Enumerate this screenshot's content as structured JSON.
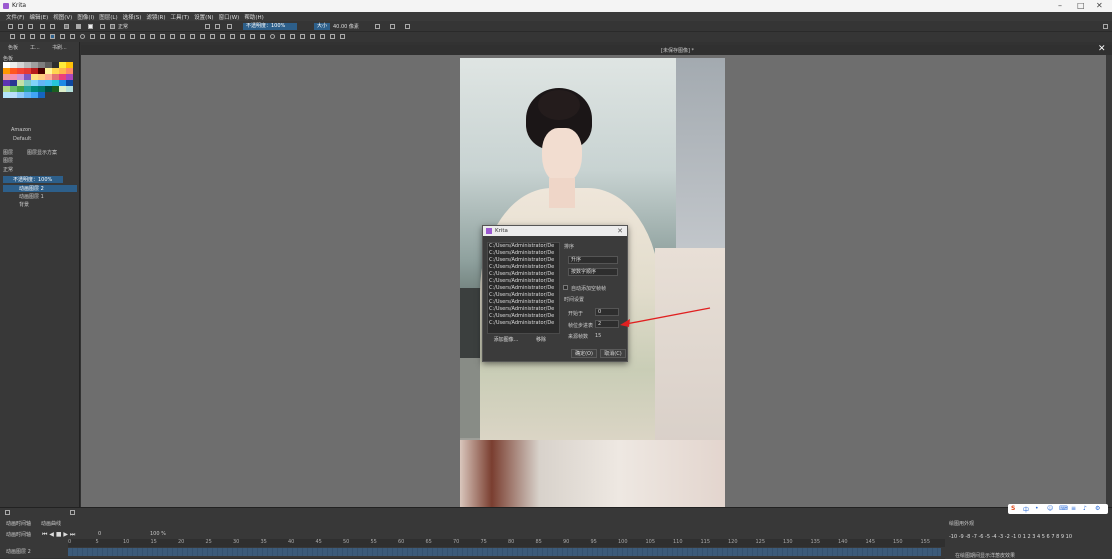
{
  "window": {
    "title": "Krita",
    "min": "–",
    "max": "□",
    "close": "✕"
  },
  "menu": [
    "文件(F)",
    "编辑(E)",
    "视图(V)",
    "图像(I)",
    "图层(L)",
    "选择(S)",
    "滤镜(R)",
    "工具(T)",
    "设置(N)",
    "窗口(W)",
    "帮助(H)"
  ],
  "toolbar": {
    "mode": "正常",
    "opacity": "不透明度：100%",
    "size_label": "大小",
    "size_value": "40.00 像素"
  },
  "left_panel": {
    "tabs": [
      "色板",
      "工...",
      "书刷..."
    ],
    "palette_title": "色板",
    "palette_name": "Amazon",
    "preset": "Default",
    "layers_tabs": [
      "图层",
      "图层显示方案"
    ],
    "layers_title": "图层",
    "blend": "正常",
    "opacity": "不透明度：100%",
    "layers": [
      "动画图层 2",
      "动画图层 1",
      "背景"
    ]
  },
  "document": {
    "tab": "[未保存图像] *"
  },
  "palette_colors": [
    "#ffffff",
    "#ececec",
    "#d4d4d4",
    "#b9b9b9",
    "#9e9e9e",
    "#7f7f7f",
    "#5c5c5c",
    "#2e2e2e",
    "#ffeb3b",
    "#ffc107",
    "#ff9800",
    "#ff5722",
    "#f44336",
    "#e53935",
    "#b71c1c",
    "#4a0000",
    "#fff59d",
    "#ffd54f",
    "#ffb74d",
    "#ff8a65",
    "#ef9a9a",
    "#f48fb1",
    "#ce93d8",
    "#7e57c2",
    "#ffe082",
    "#ffcc80",
    "#ffab91",
    "#e57373",
    "#ec407a",
    "#ab47bc",
    "#5e35b1",
    "#283593",
    "#c5e1a5",
    "#80cbc4",
    "#81d4fa",
    "#64b5f6",
    "#4fc3f7",
    "#26c6da",
    "#1e88e5",
    "#0d47a1",
    "#aed581",
    "#66bb6a",
    "#43a047",
    "#26a69a",
    "#00897b",
    "#00796b",
    "#004d40",
    "#1b5e20",
    "#dcedc8",
    "#b2dfdb",
    "#b3e5fc",
    "#bbdefb",
    "#90caf9",
    "#64b5f6",
    "#42a5f5",
    "#1565c0"
  ],
  "dialog": {
    "title": "Krita",
    "files": [
      "C:/Users/Administrator/De",
      "C:/Users/Administrator/De",
      "C:/Users/Administrator/De",
      "C:/Users/Administrator/De",
      "C:/Users/Administrator/De",
      "C:/Users/Administrator/De",
      "C:/Users/Administrator/De",
      "C:/Users/Administrator/De",
      "C:/Users/Administrator/De",
      "C:/Users/Administrator/De",
      "C:/Users/Administrator/De",
      "C:/Users/Administrator/De"
    ],
    "order_label": "排序",
    "order_value": "升序",
    "order_by": "按数字顺序",
    "auto_label": "自动添加空帧帧",
    "time_label": "时间设置",
    "start_label": "开始于",
    "start_value": "0",
    "step_label": "帧位步进表",
    "step_value": "2",
    "source_label": "来源帧数",
    "source_value": "15",
    "add_button": "添加图像...",
    "remove_button": "移除",
    "ok_button": "确定(O)",
    "cancel_button": "取消(C)"
  },
  "timeline": {
    "tabs": [
      "动画时间轴",
      "动画曲线"
    ],
    "title": "动画时间轴",
    "frame": "0",
    "zoom": "100 %",
    "ruler": [
      "0",
      "5",
      "10",
      "15",
      "20",
      "25",
      "30",
      "35",
      "40",
      "45",
      "50",
      "55",
      "60",
      "65",
      "70",
      "75",
      "80",
      "85",
      "90",
      "95",
      "100",
      "105",
      "110",
      "115",
      "120",
      "125",
      "130",
      "135",
      "140",
      "145",
      "150",
      "155"
    ],
    "layer_row": "动画图层 2",
    "onion_title": "绘图用外观",
    "onion_numbers": "-10 -9 -8 -7 -6 -5 -4 -3 -2 -1 0 1 2 3 4 5 6 7 8 9 10",
    "onion_footer": "在绘图期间显示洋葱皮效果"
  },
  "ime": {
    "items": [
      "S",
      "中",
      "•",
      "☺",
      "⌨",
      "≡",
      "♪",
      "⚙"
    ]
  }
}
